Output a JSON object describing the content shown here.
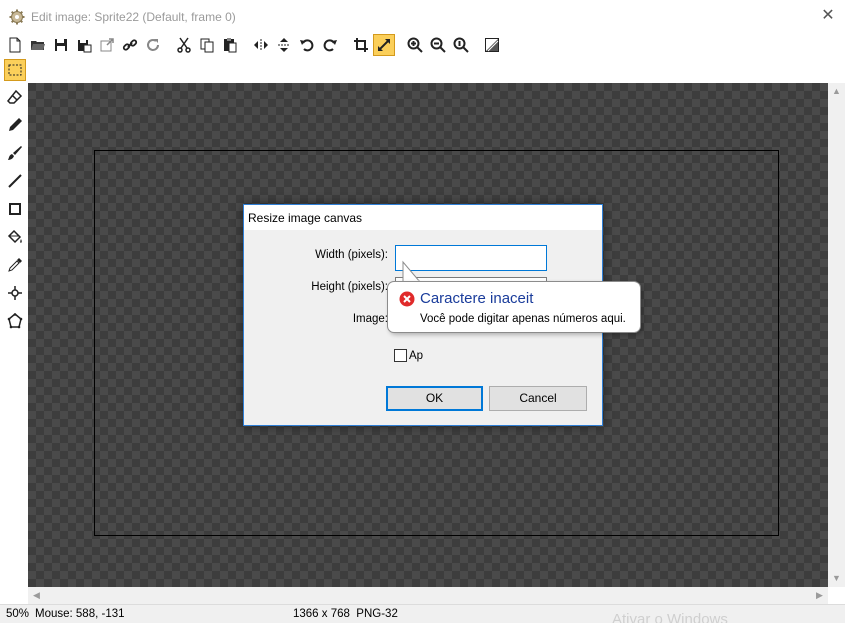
{
  "window": {
    "title": "Edit image: Sprite22 (Default, frame 0)",
    "close_icon": "close-icon"
  },
  "toolbar": {
    "buttons": [
      {
        "name": "new-icon"
      },
      {
        "name": "open-folder-icon"
      },
      {
        "name": "save-icon"
      },
      {
        "name": "save-as-icon"
      },
      {
        "name": "export-icon"
      },
      {
        "name": "link-icon"
      },
      {
        "name": "refresh-icon"
      },
      {
        "name": "cut-icon"
      },
      {
        "name": "copy-icon"
      },
      {
        "name": "paste-icon"
      },
      {
        "name": "flip-horizontal-icon"
      },
      {
        "name": "flip-vertical-icon"
      },
      {
        "name": "rotate-left-icon"
      },
      {
        "name": "rotate-right-icon"
      },
      {
        "name": "crop-icon"
      },
      {
        "name": "resize-canvas-icon",
        "active": true
      },
      {
        "name": "zoom-in-icon"
      },
      {
        "name": "zoom-out-icon"
      },
      {
        "name": "zoom-actual-icon"
      },
      {
        "name": "effects-icon"
      }
    ]
  },
  "tools": [
    {
      "name": "select-rectangle-icon",
      "active": true
    },
    {
      "name": "eraser-icon"
    },
    {
      "name": "pencil-icon"
    },
    {
      "name": "brush-icon"
    },
    {
      "name": "line-icon"
    },
    {
      "name": "rectangle-icon"
    },
    {
      "name": "fill-bucket-icon"
    },
    {
      "name": "eyedropper-icon"
    },
    {
      "name": "move-point-icon"
    },
    {
      "name": "polygon-icon"
    }
  ],
  "status": {
    "zoom": "50%",
    "mouse": "Mouse: 588, -131",
    "size_format": "1366 x 768  PNG-32",
    "watermark": "Ativar o Windows"
  },
  "dialog": {
    "title": "Resize image canvas",
    "width_label": "Width (pixels):",
    "width_value": "",
    "height_label": "Height (pixels):",
    "image_label": "Image:",
    "checkbox_label": "Ap",
    "ok_label": "OK",
    "cancel_label": "Cancel"
  },
  "balloon": {
    "title": "Caractere inaceit",
    "message": "Você pode digitar apenas números aqui.",
    "icon": "error-icon",
    "accent": "#e02a2a"
  },
  "colors": {
    "canvas_dark": "#3d3d3d",
    "canvas_light": "#4a4a4a",
    "active_tool": "#fbcf5a",
    "focus_blue": "#0078d7"
  }
}
